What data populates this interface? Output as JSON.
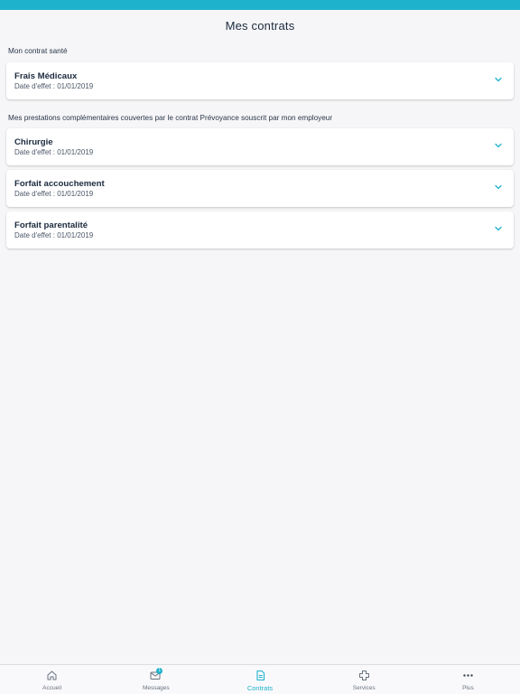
{
  "header": {
    "title": "Mes contrats"
  },
  "sections": {
    "health": {
      "label": "Mon contrat santé",
      "cards": [
        {
          "title": "Frais Médicaux",
          "date": "Date d'effet : 01/01/2019"
        }
      ]
    },
    "provident": {
      "label": "Mes prestations complémentaires couvertes par le contrat Prévoyance souscrit par mon employeur",
      "cards": [
        {
          "title": "Chirurgie",
          "date": "Date d'effet : 01/01/2019"
        },
        {
          "title": "Forfait accouchement",
          "date": "Date d'effet : 01/01/2019"
        },
        {
          "title": "Forfait parentalité",
          "date": "Date d'effet : 01/01/2019"
        }
      ]
    }
  },
  "tabbar": {
    "items": [
      {
        "label": "Accueil",
        "icon": "home-icon"
      },
      {
        "label": "Messages",
        "icon": "envelope-icon",
        "badge": "1"
      },
      {
        "label": "Contrats",
        "icon": "document-icon",
        "active": true
      },
      {
        "label": "Services",
        "icon": "medical-cross-icon"
      },
      {
        "label": "Plus",
        "icon": "more-dots-icon"
      }
    ]
  },
  "colors": {
    "accent": "#1fb2cc",
    "background": "#f6f6f8",
    "text": "#1b2a3d"
  }
}
